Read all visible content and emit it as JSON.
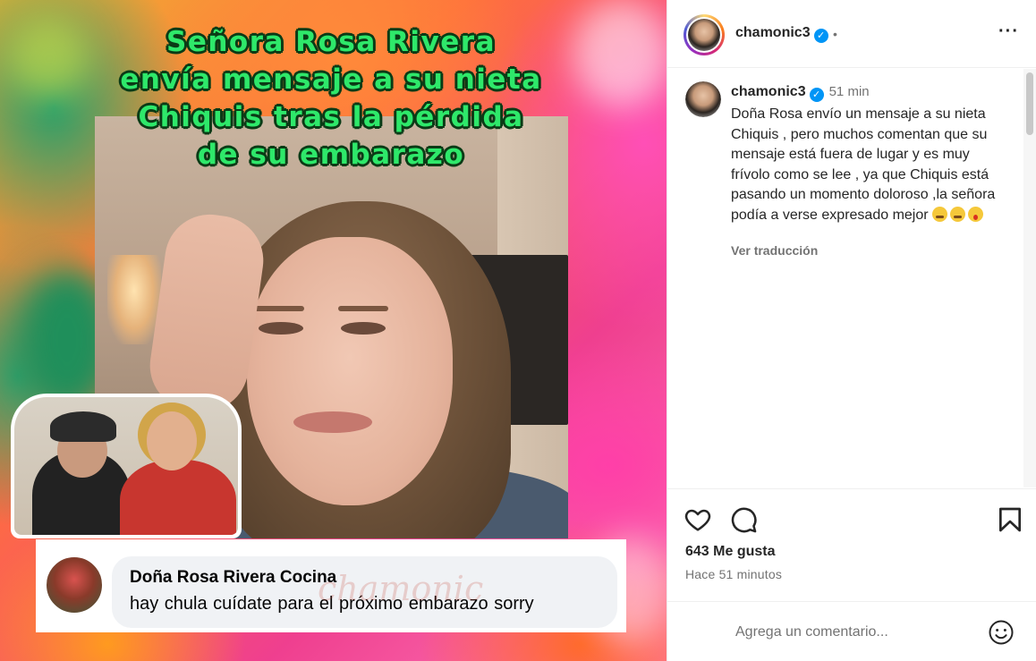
{
  "media": {
    "headline": [
      "Señora Rosa Rivera",
      "envía mensaje a su nieta",
      "Chiquis tras la pérdida",
      "de su embarazo"
    ],
    "comment": {
      "name": "Doña Rosa Rivera Cocina",
      "text": "hay chula cuídate para el próximo embarazo   sorry",
      "watermark": "chamonic"
    }
  },
  "post": {
    "header": {
      "username": "chamonic3",
      "verified_mark": "✓",
      "separator": "•",
      "more_icon": "···"
    },
    "caption": {
      "username": "chamonic3",
      "time": "51 min",
      "text": "Doña Rosa envío un mensaje a su nieta Chiquis , pero muchos comentan que su mensaje está fuera de lugar y es muy frívolo como se lee , ya que Chiquis está pasando un momento doloroso ,la señora podía a verse expresado mejor",
      "translate": "Ver traducción"
    },
    "likes": "643 Me gusta",
    "ago": "Hace 51 minutos",
    "add_comment_placeholder": "Agrega un comentario..."
  },
  "colors": {
    "headline_green": "#2ee86a",
    "verified_blue": "#0095f6",
    "secondary_text": "#737373"
  }
}
